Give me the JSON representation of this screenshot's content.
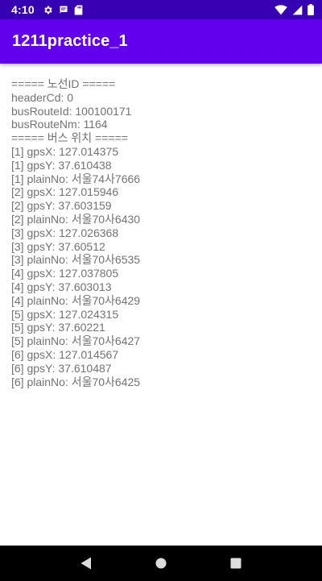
{
  "status_bar": {
    "time": "4:10",
    "icons": [
      "gear-icon",
      "message-icon",
      "sd-card-icon",
      "wifi-icon",
      "signal-icon",
      "battery-icon"
    ]
  },
  "app_bar": {
    "title": "1211practice_1"
  },
  "log_lines": [
    "===== 노선ID =====",
    "headerCd: 0",
    "busRouteId: 100100171",
    "busRouteNm: 1164",
    "===== 버스 위치 =====",
    "[1] gpsX: 127.014375",
    "[1] gpsY: 37.610438",
    "[1] plainNo: 서울74사7666",
    "[2] gpsX: 127.015946",
    "[2] gpsY: 37.603159",
    "[2] plainNo: 서울70사6430",
    "[3] gpsX: 127.026368",
    "[3] gpsY: 37.60512",
    "[3] plainNo: 서울70사6535",
    "[4] gpsX: 127.037805",
    "[4] gpsY: 37.603013",
    "[4] plainNo: 서울70사6429",
    "[5] gpsX: 127.024315",
    "[5] gpsY: 37.60221",
    "[5] plainNo: 서울70사6427",
    "[6] gpsX: 127.014567",
    "[6] gpsY: 37.610487",
    "[6] plainNo: 서울70사6425"
  ],
  "nav_bar": {
    "buttons": [
      "back-button",
      "home-button",
      "recents-button"
    ]
  },
  "colors": {
    "status_bar": "#3700B3",
    "app_bar": "#6200EE",
    "text": "#737373",
    "nav_bar": "#000000"
  }
}
